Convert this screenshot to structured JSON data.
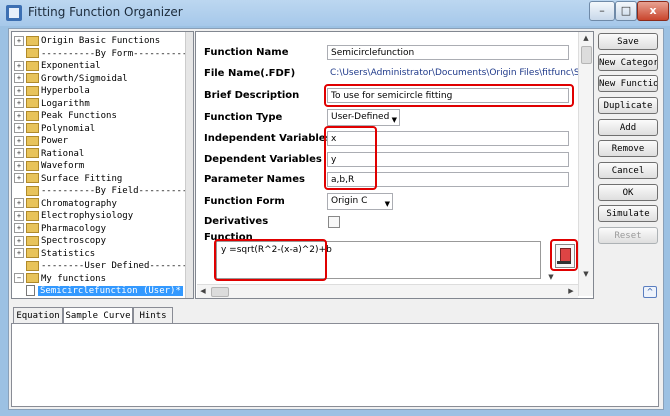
{
  "window": {
    "title": "Fitting Function Organizer",
    "controls": {
      "minimize": "–",
      "maximize": "□",
      "close": "x"
    }
  },
  "tree": {
    "items": [
      {
        "label": "Origin Basic Functions",
        "kind": "folder",
        "expander": "+"
      },
      {
        "label": "----------By Form----------",
        "kind": "separator",
        "expander": ""
      },
      {
        "label": "Exponential",
        "kind": "folder",
        "expander": "+"
      },
      {
        "label": "Growth/Sigmoidal",
        "kind": "folder",
        "expander": "+"
      },
      {
        "label": "Hyperbola",
        "kind": "folder",
        "expander": "+"
      },
      {
        "label": "Logarithm",
        "kind": "folder",
        "expander": "+"
      },
      {
        "label": "Peak Functions",
        "kind": "folder",
        "expander": "+"
      },
      {
        "label": "Polynomial",
        "kind": "folder",
        "expander": "+"
      },
      {
        "label": "Power",
        "kind": "folder",
        "expander": "+"
      },
      {
        "label": "Rational",
        "kind": "folder",
        "expander": "+"
      },
      {
        "label": "Waveform",
        "kind": "folder",
        "expander": "+"
      },
      {
        "label": "Surface Fitting",
        "kind": "folder",
        "expander": "+"
      },
      {
        "label": "----------By Field----------",
        "kind": "separator",
        "expander": ""
      },
      {
        "label": "Chromatography",
        "kind": "folder",
        "expander": "+"
      },
      {
        "label": "Electrophysiology",
        "kind": "folder",
        "expander": "+"
      },
      {
        "label": "Pharmacology",
        "kind": "folder",
        "expander": "+"
      },
      {
        "label": "Spectroscopy",
        "kind": "folder",
        "expander": "+"
      },
      {
        "label": "Statistics",
        "kind": "folder",
        "expander": "+"
      },
      {
        "label": "--------User Defined--------",
        "kind": "separator",
        "expander": ""
      },
      {
        "label": "My functions",
        "kind": "folder",
        "expander": "−"
      },
      {
        "label": "Semicirclefunction (User)*",
        "kind": "file",
        "expander": "",
        "selected": true
      }
    ]
  },
  "props": {
    "function_name": {
      "label": "Function Name",
      "value": "Semicirclefunction"
    },
    "file_name": {
      "label": "File Name(.FDF)",
      "value": "C:\\Users\\Administrator\\Documents\\Origin Files\\fitfunc\\Semicirc"
    },
    "brief_description": {
      "label": "Brief Description",
      "value": "To use for semicircle fitting"
    },
    "function_type": {
      "label": "Function Type",
      "value": "User-Defined"
    },
    "independent_variables": {
      "label": "Independent Variables",
      "value": "x"
    },
    "dependent_variables": {
      "label": "Dependent Variables",
      "value": "y"
    },
    "parameter_names": {
      "label": "Parameter Names",
      "value": "a,b,R"
    },
    "function_form": {
      "label": "Function Form",
      "value": "Origin C"
    },
    "derivatives": {
      "label": "Derivatives",
      "checked": false
    },
    "function": {
      "label": "Function",
      "value": "y =sqrt(R^2-(x-a)^2)+b"
    }
  },
  "buttons": {
    "save": "Save",
    "new_category": "New Category",
    "new_function": "New Function",
    "duplicate": "Duplicate",
    "add": "Add",
    "remove": "Remove",
    "cancel": "Cancel",
    "ok": "OK",
    "simulate": "Simulate",
    "reset": "Reset",
    "collapse": "^"
  },
  "tabs": {
    "items": [
      "Equation",
      "Sample Curve",
      "Hints"
    ],
    "active": "Sample Curve"
  },
  "colors": {
    "highlight": "#e00000",
    "selection": "#3399ff",
    "title_bar": "#a6c8ea"
  }
}
